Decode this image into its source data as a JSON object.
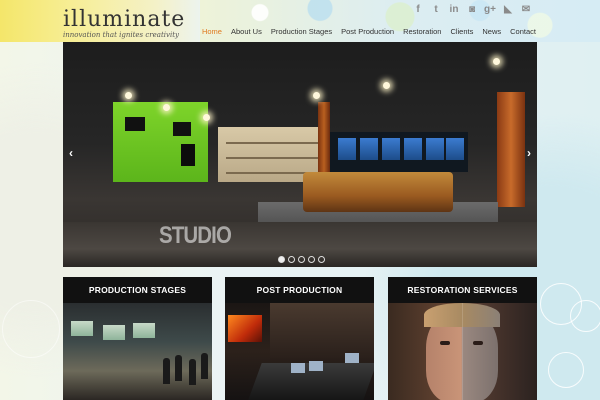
{
  "brand": {
    "name": "illuminate",
    "tagline": "innovation that ignites creativity"
  },
  "social": [
    {
      "icon": "facebook-icon",
      "glyph": "f"
    },
    {
      "icon": "twitter-icon",
      "glyph": "t"
    },
    {
      "icon": "linkedin-icon",
      "glyph": "in"
    },
    {
      "icon": "instagram-icon",
      "glyph": "◙"
    },
    {
      "icon": "googleplus-icon",
      "glyph": "g+"
    },
    {
      "icon": "rss-icon",
      "glyph": "◣"
    },
    {
      "icon": "email-icon",
      "glyph": "✉"
    }
  ],
  "nav": {
    "active": "Home",
    "items": [
      "Home",
      "About Us",
      "Production Stages",
      "Post Production",
      "Restoration",
      "Clients",
      "News",
      "Contact"
    ]
  },
  "slider": {
    "caption": "STUDIO",
    "prev_glyph": "‹",
    "next_glyph": "›",
    "dot_count": 5,
    "active_dot": 1
  },
  "cards": [
    {
      "title": "PRODUCTION STAGES"
    },
    {
      "title": "POST PRODUCTION"
    },
    {
      "title": "RESTORATION SERVICES"
    }
  ],
  "colors": {
    "accent": "#e07a1f",
    "logo_band": "#f4e66a",
    "card_bg": "#111111"
  }
}
